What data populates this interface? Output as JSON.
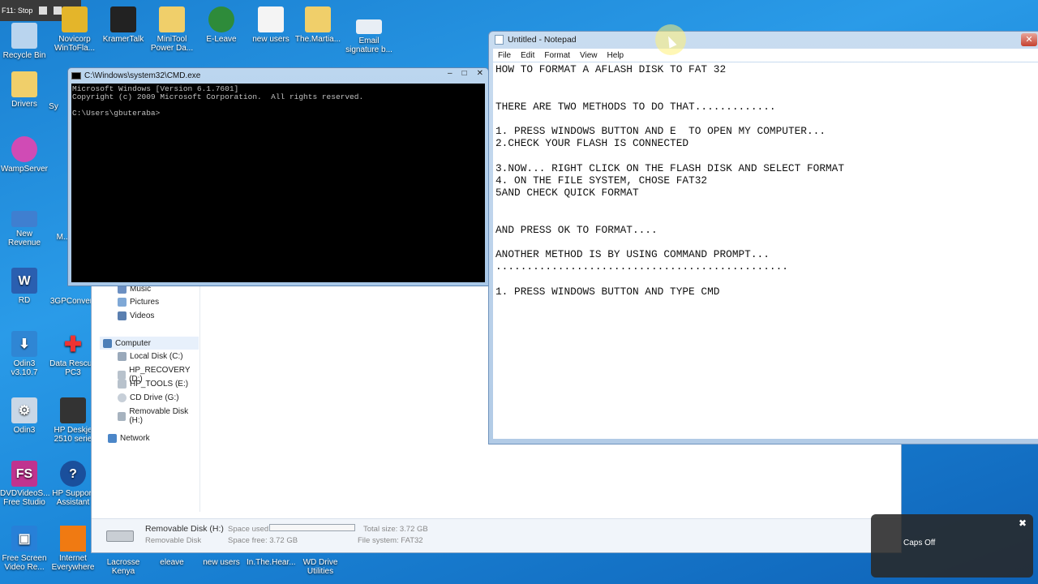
{
  "recording": {
    "label": "F11: Stop"
  },
  "desktop_icons": {
    "recycle_bin": "Recycle Bin",
    "novicorp": "Novicorp WinToFla...",
    "kramertalk": "KramerTalk",
    "minitool": "MiniTool Power Da...",
    "eleave": "E-Leave",
    "new_users": "new users",
    "martian": "The.Martia...",
    "email_sig": "Email signature b...",
    "drivers": "Drivers",
    "sy": "Sy",
    "wampserver": "WampServer",
    "new_revenue": "New Revenue",
    "m": "M...",
    "rd": "RD",
    "3gp": "3GPConver",
    "odin3v": "Odin3 v3.10.7",
    "data_rescue": "Data Rescue PC3",
    "odin3": "Odin3",
    "hp_deskjet": "HP Deskje 2510 serie",
    "dvdvideosoft": "DVDVideoS... Free Studio",
    "hp_support": "HP Support Assistant",
    "free_screen": "Free Screen Video Re...",
    "internet_everywhere": "Internet Everywhere",
    "lacrosse": "Lacrosse Kenya",
    "eleave2": "eleave",
    "new_users2": "new users",
    "in_the_heart": "In.The.Hear...",
    "wd_drive": "WD Drive Utilities"
  },
  "cmd": {
    "title": "C:\\Windows\\system32\\CMD.exe",
    "lines": "Microsoft Windows [Version 6.1.7601]\nCopyright (c) 2009 Microsoft Corporation.  All rights reserved.\n\nC:\\Users\\gbuteraba>"
  },
  "notepad": {
    "title": "Untitled - Notepad",
    "menu": [
      "File",
      "Edit",
      "Format",
      "View",
      "Help"
    ],
    "text": "HOW TO FORMAT A AFLASH DISK TO FAT 32\n\n\nTHERE ARE TWO METHODS TO DO THAT.............\n\n1. PRESS WINDOWS BUTTON AND E  TO OPEN MY COMPUTER...\n2.CHECK YOUR FLASH IS CONNECTED\n\n3.NOW... RIGHT CLICK ON THE FLASH DISK AND SELECT FORMAT\n4. ON THE FILE SYSTEM, CHOSE FAT32\n5AND CHECK QUICK FORMAT\n\n\nAND PRESS OK TO FORMAT....\n\nANOTHER METHOD IS BY USING COMMAND PROMPT...\n...............................................\n\n1. PRESS WINDOWS BUTTON AND TYPE CMD"
  },
  "explorer": {
    "nav": {
      "music": "Music",
      "pictures": "Pictures",
      "videos": "Videos",
      "computer": "Computer",
      "local_disk": "Local Disk (C:)",
      "hp_recovery": "HP_RECOVERY (D:)",
      "hp_tools": "HP_TOOLS (E:)",
      "cd_drive": "CD Drive (G:)",
      "removable": "Removable Disk (H:)",
      "network": "Network"
    },
    "status": {
      "drive_name": "Removable Disk (H:)",
      "drive_type": "Removable Disk",
      "space_used_label": "Space used:",
      "space_free": "Space free: 3.72 GB",
      "total_size": "Total size: 3.72 GB",
      "file_system": "File system: FAT32",
      "space_used_fraction": 0.0
    }
  },
  "toast": {
    "message": "Caps Off"
  }
}
